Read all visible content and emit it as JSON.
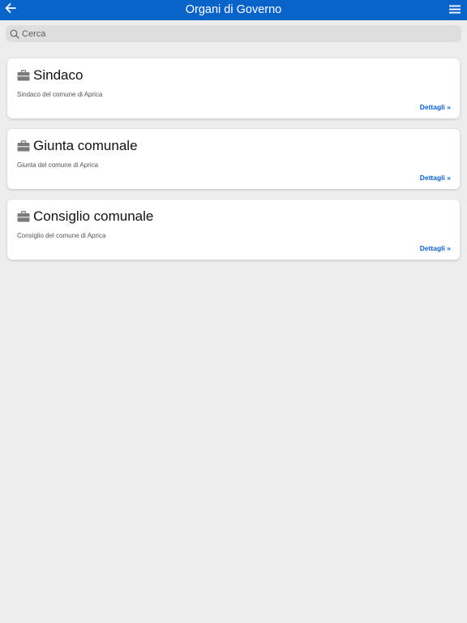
{
  "header": {
    "title": "Organi di Governo",
    "back_icon": "arrow-left-icon",
    "menu_icon": "hamburger-menu-icon",
    "color": "#0a63c9"
  },
  "search": {
    "placeholder": "Cerca",
    "value": "",
    "icon": "search-icon"
  },
  "items": [
    {
      "title": "Sindaco",
      "description": "Sindaco del comune di Aprica",
      "link": "Dettagli »",
      "icon": "briefcase-icon"
    },
    {
      "title": "Giunta comunale",
      "description": "Giunta del comune di Aprica",
      "link": "Dettagli »",
      "icon": "briefcase-icon"
    },
    {
      "title": "Consiglio comunale",
      "description": "Consiglio del comune di Aprica",
      "link": "Dettagli »",
      "icon": "briefcase-icon"
    }
  ]
}
